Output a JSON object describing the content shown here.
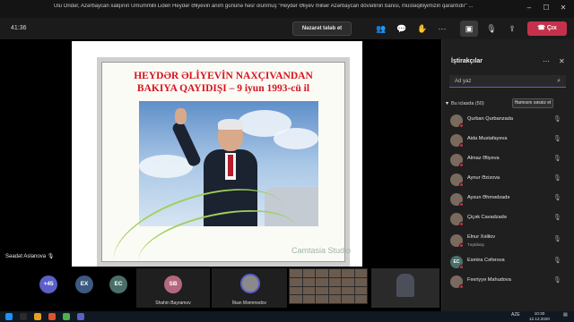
{
  "window": {
    "title": "Ulu Öndər, Azərbaycan xalqının Ümummilli Lideri Heydər Əliyevin anım gününə həsr olunmuş \"Heydər Əliyev milləir Azərbaycan dövlətinin banisi, müstəqilliyimizin qarantıdır\" ...",
    "minimize_icon": "minimize-icon",
    "maximize_icon": "maximize-icon",
    "close_icon": "close-icon"
  },
  "toolbar": {
    "timer": "41:36",
    "request_control_label": "Nəzarət tələb et",
    "leave_label": "Çıx"
  },
  "slide": {
    "title_line1": "HEYDƏR ƏLİYEVİN NAXÇIVANDAN",
    "title_line2": "BAKIYA QAYIDIŞI –  9 iyun 1993-cü il",
    "watermark": "Camtasia Studio"
  },
  "stage": {
    "presenter_name": "Səadət Aslanova"
  },
  "strip": {
    "overflow_count": "+45",
    "initials": [
      "EX",
      "EC"
    ],
    "participants": [
      {
        "initials": "SB",
        "name": "Shahin Bayramov"
      },
      {
        "initials": "",
        "name": "İlkan Məmmədov"
      }
    ]
  },
  "panel": {
    "title": "İştirakçılar",
    "search_placeholder": "Ad yaz",
    "section_label": "Bu iclasda (50)",
    "mute_all_label": "Hamısını səssiz et",
    "participants": [
      {
        "name": "Qurban Qurbanzada",
        "initials": "",
        "sub": ""
      },
      {
        "name": "Aida Mustafayeva",
        "initials": "",
        "sub": ""
      },
      {
        "name": "Almaz Əliyeva",
        "initials": "",
        "sub": ""
      },
      {
        "name": "Aynur Əzizova",
        "initials": "",
        "sub": ""
      },
      {
        "name": "Aysun Əhmədzadə",
        "initials": "",
        "sub": ""
      },
      {
        "name": "Çiçək Cavadzadə",
        "initials": "",
        "sub": ""
      },
      {
        "name": "Elnur Xəlilov",
        "initials": "",
        "sub": "Təşkilatçı"
      },
      {
        "name": "Esmira Cəfərova",
        "initials": "EC",
        "sub": ""
      },
      {
        "name": "Fəxriyyə Mahudova",
        "initials": "",
        "sub": ""
      }
    ]
  },
  "taskbar": {
    "lang": "AZE",
    "time": "10:30",
    "date": "12.12.2020"
  },
  "colors": {
    "leave": "#c4314b",
    "slide_title": "#d7131c",
    "accent": "#5b5fc7"
  }
}
